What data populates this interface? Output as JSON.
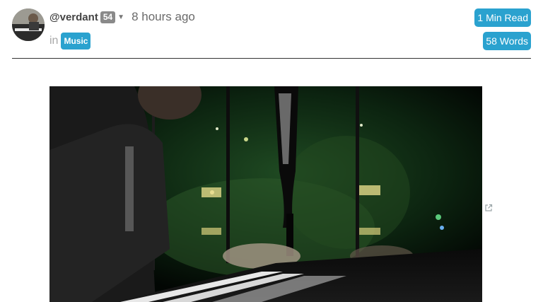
{
  "author": {
    "username": "@verdant",
    "reputation": "54",
    "time_ago": "8 hours ago"
  },
  "category": {
    "prefix": "in",
    "tag": "Music"
  },
  "stats": {
    "read_time": "1 Min Read",
    "word_count": "58 Words"
  },
  "colors": {
    "accent": "#2aa2cf",
    "rep_badge": "#8a8a8a"
  },
  "icons": {
    "dropdown": "chevron-down-icon",
    "external": "external-link-icon"
  }
}
